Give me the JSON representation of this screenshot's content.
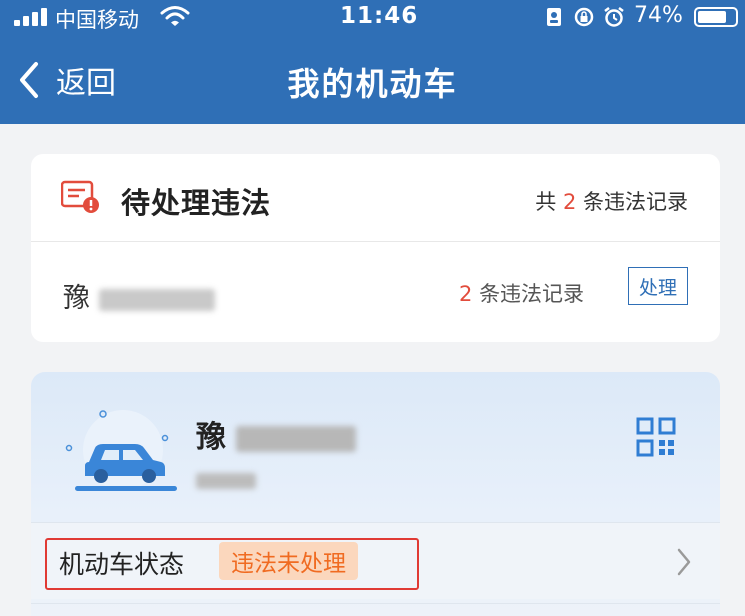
{
  "status_bar": {
    "carrier": "中国移动",
    "time": "11:46",
    "battery": "74%"
  },
  "nav": {
    "back_label": "返回",
    "title": "我的机动车"
  },
  "pending": {
    "title": "待处理违法",
    "total_prefix": "共",
    "total_count": "2",
    "total_suffix": "条违法记录",
    "row": {
      "plate_prefix": "豫",
      "count": "2",
      "count_suffix": "条违法记录",
      "action": "处理"
    }
  },
  "vehicle": {
    "plate_prefix": "豫",
    "status_label": "机动车状态",
    "status_badge": "违法未处理"
  },
  "colors": {
    "header": "#2f6fb6",
    "accent_red": "#e24c3c",
    "badge_bg": "#fbd7bd",
    "badge_text": "#f06b21",
    "highlight": "#e03a34"
  }
}
